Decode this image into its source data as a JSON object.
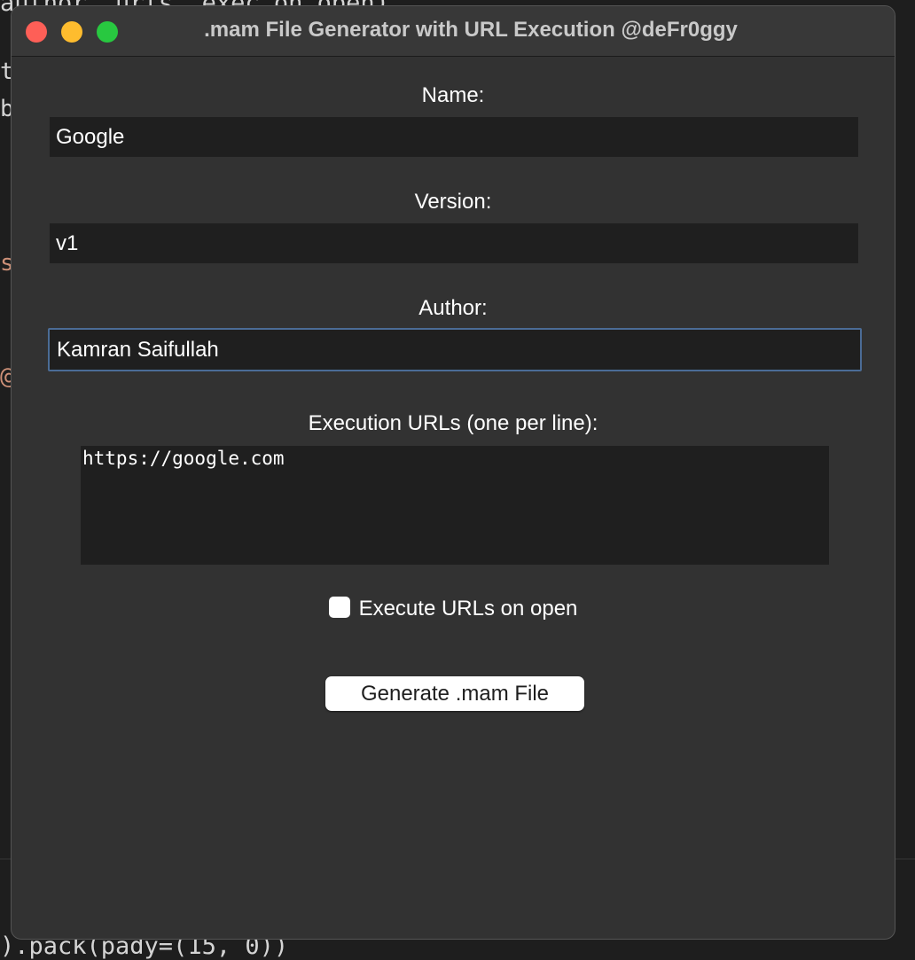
{
  "window": {
    "title": ".mam File Generator with URL Execution @deFr0ggy"
  },
  "form": {
    "name_label": "Name:",
    "name_value": "Google",
    "version_label": "Version:",
    "version_value": "v1",
    "author_label": "Author:",
    "author_value": "Kamran Saifullah",
    "urls_label": "Execution URLs (one per line):",
    "urls_value": "https://google.com",
    "execute_checkbox_label": "Execute URLs on open",
    "execute_checked": false,
    "generate_button_label": "Generate .mam File"
  },
  "background": {
    "top_code": "author, urls, exec_on_open)",
    "bottom_code": ").pack(pady=(15, 0))",
    "side_fragments": [
      "t",
      "b",
      "s",
      "@"
    ]
  },
  "colors": {
    "window_bg": "#323232",
    "titlebar_bg": "#383838",
    "input_bg": "#1f1f1f",
    "focus_border": "#4b6c96",
    "close": "#fe5f57",
    "minimize": "#febc2e",
    "maximize": "#28c840"
  }
}
